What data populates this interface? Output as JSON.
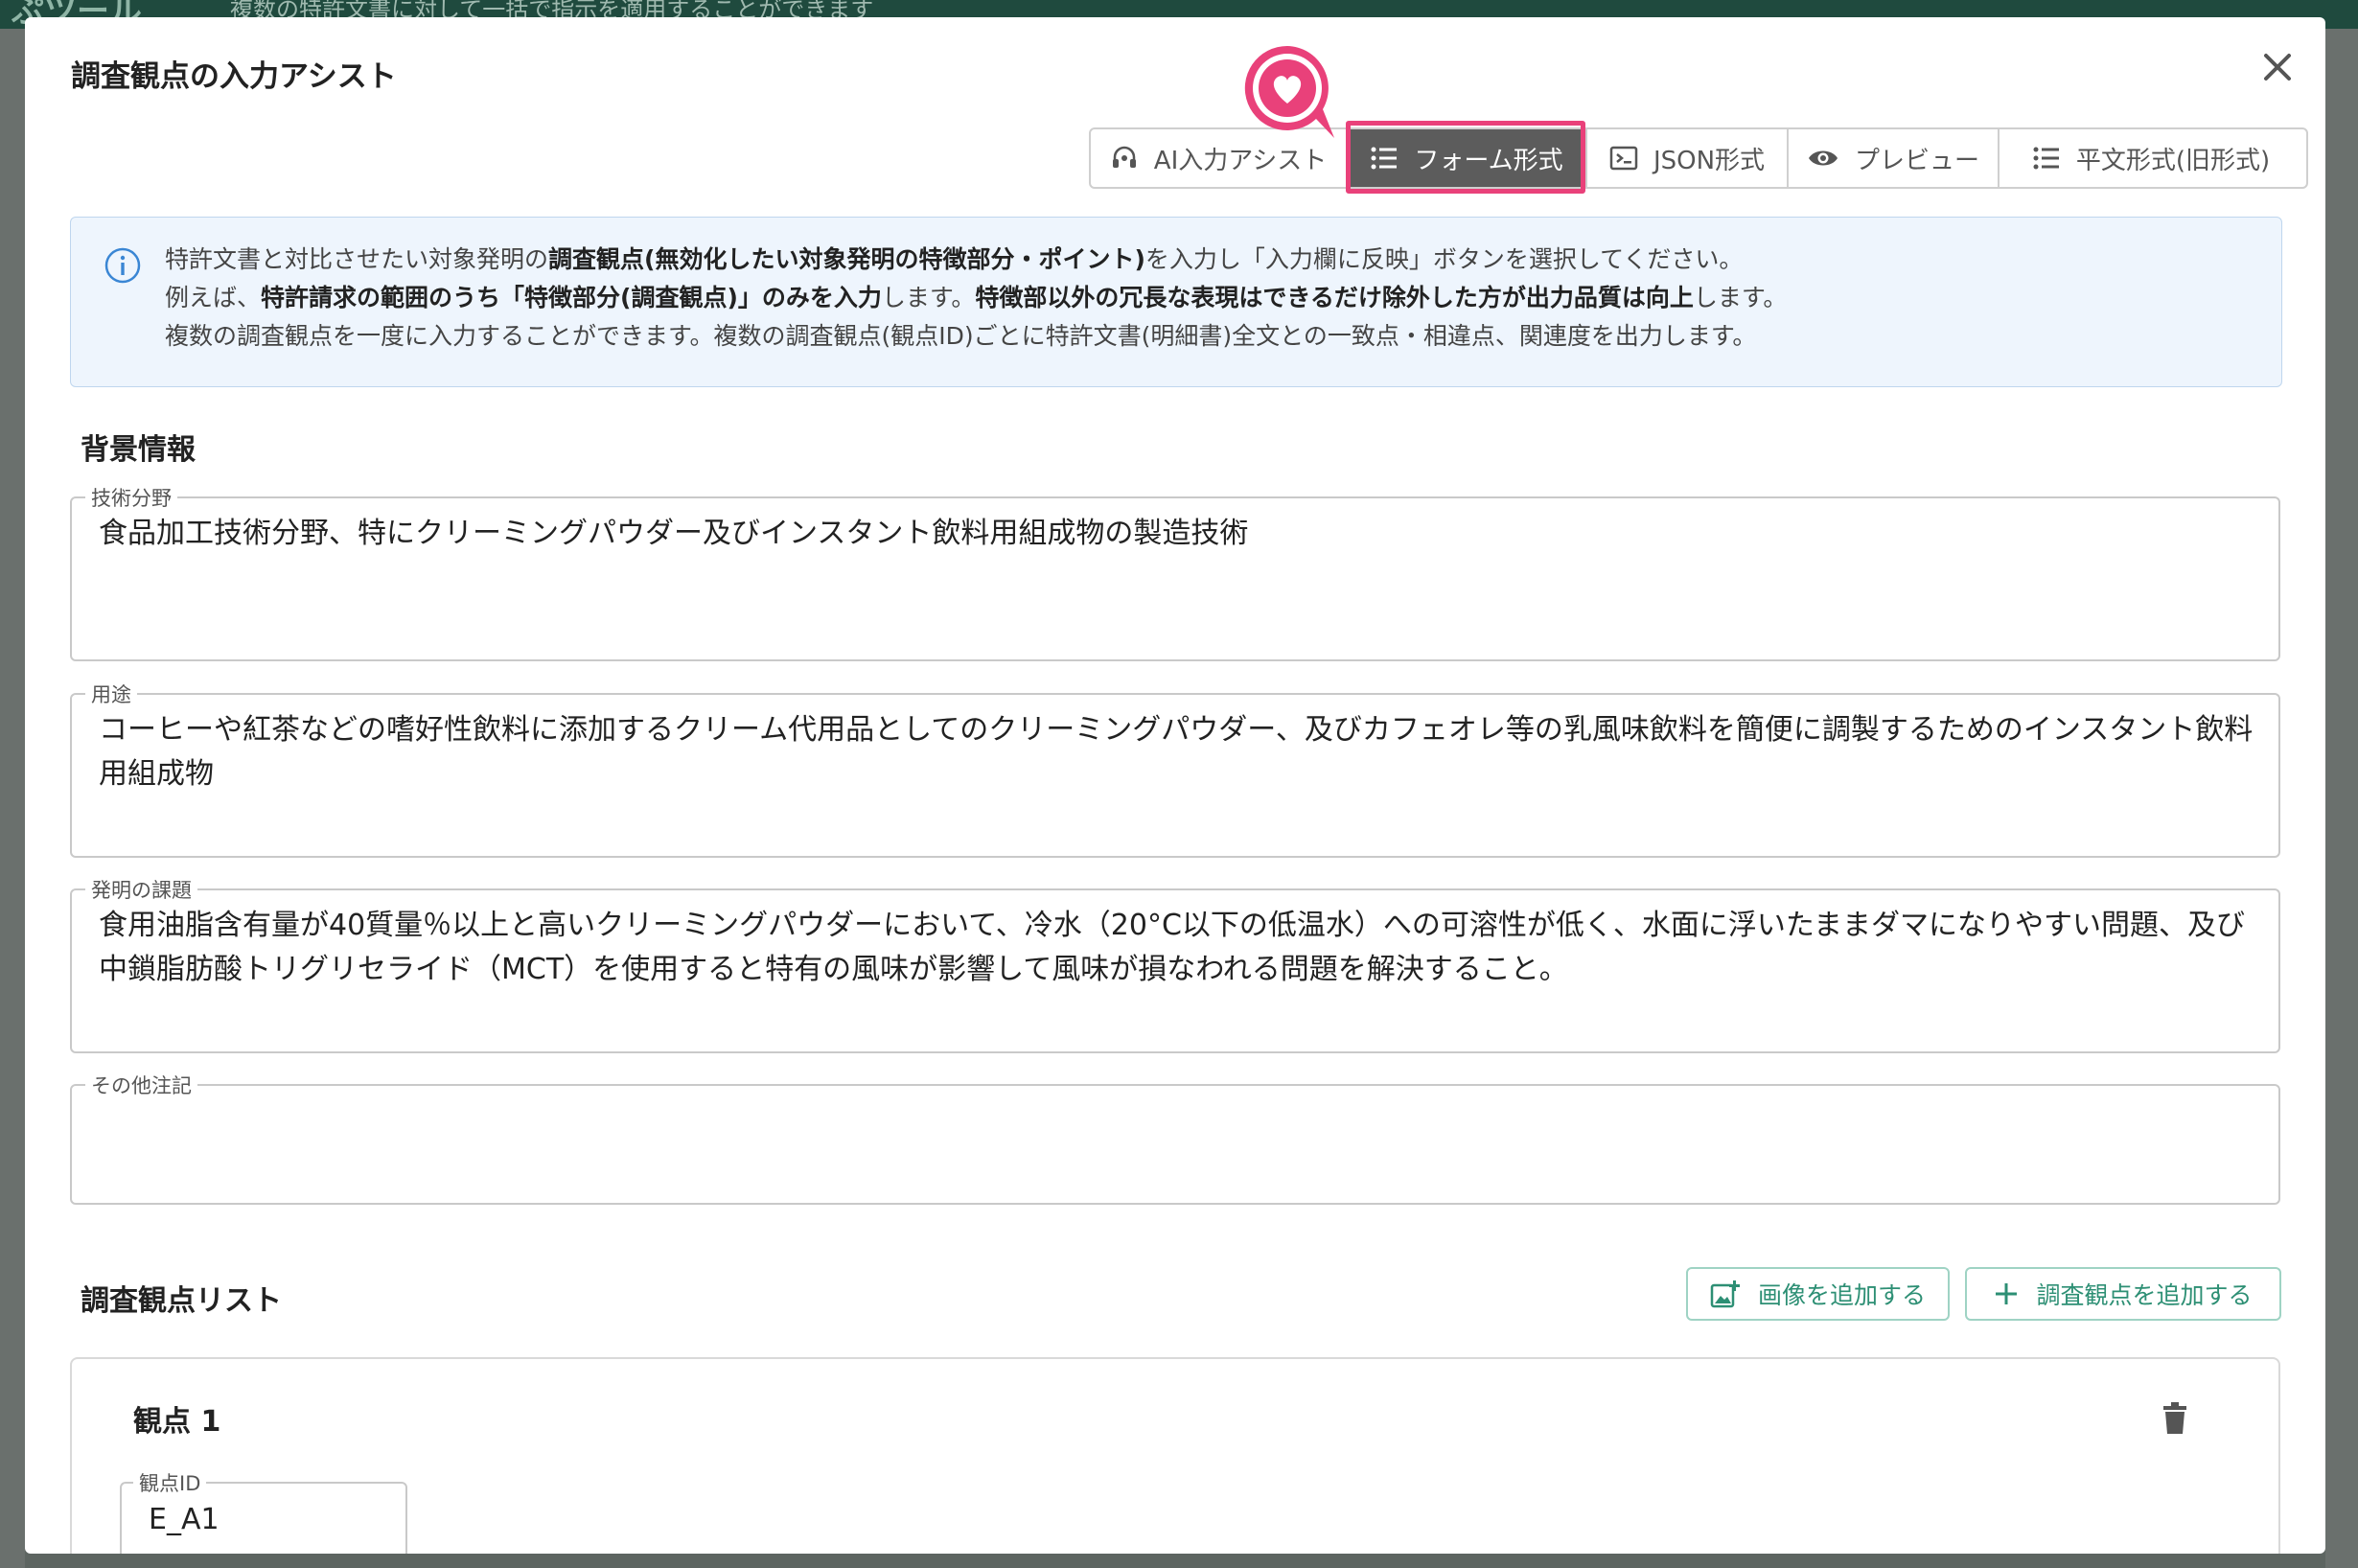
{
  "background": {
    "app_title": "ぷツール",
    "app_subtitle": "複数の特許文書に対して一括で指示を適用することができます"
  },
  "modal": {
    "title": "調査観点の入力アシスト",
    "close_label": "×"
  },
  "tabs": [
    {
      "label": "AI入力アシスト",
      "icon": "headset-icon",
      "active": false
    },
    {
      "label": "フォーム形式",
      "icon": "list-icon",
      "active": true
    },
    {
      "label": "JSON形式",
      "icon": "terminal-icon",
      "active": false
    },
    {
      "label": "プレビュー",
      "icon": "eye-icon",
      "active": false
    },
    {
      "label": "平文形式(旧形式)",
      "icon": "list-icon",
      "active": false
    }
  ],
  "info": {
    "line1_a": "特許文書と対比させたい対象発明の",
    "line1_b": "調査観点(無効化したい対象発明の特徴部分・ポイント)",
    "line1_c": "を入力し「入力欄に反映」ボタンを選択してください。",
    "line2_a": "例えば、",
    "line2_b": "特許請求の範囲のうち「特徴部分(調査観点)」のみを入力",
    "line2_c": "します。",
    "line2_d": "特徴部以外の冗長な表現はできるだけ除外した方が出力品質は向上",
    "line2_e": "します。",
    "line3": "複数の調査観点を一度に入力することができます。複数の調査観点(観点ID)ごとに特許文書(明細書)全文との一致点・相違点、関連度を出力します。"
  },
  "background_section": {
    "title": "背景情報",
    "fields": {
      "tech_field": {
        "label": "技術分野",
        "value": "食品加工技術分野、特にクリーミングパウダー及びインスタント飲料用組成物の製造技術"
      },
      "usage": {
        "label": "用途",
        "value": "コーヒーや紅茶などの嗜好性飲料に添加するクリーム代用品としてのクリーミングパウダー、及びカフェオレ等の乳風味飲料を簡便に調製するためのインスタント飲料用組成物"
      },
      "problem": {
        "label": "発明の課題",
        "value": "食用油脂含有量が40質量％以上と高いクリーミングパウダーにおいて、冷水（20°C以下の低温水）への可溶性が低く、水面に浮いたままダマになりやすい問題、及び中鎖脂肪酸トリグリセライド（MCT）を使用すると特有の風味が影響して風味が損なわれる問題を解決すること。"
      },
      "notes": {
        "label": "その他注記",
        "value": ""
      }
    }
  },
  "viewpoints_section": {
    "title": "調査観点リスト",
    "add_image_label": "画像を追加する",
    "add_viewpoint_label": "調査観点を追加する",
    "items": [
      {
        "title": "観点 1",
        "id_label": "観点ID",
        "id_value": "E_A1"
      }
    ]
  },
  "colors": {
    "accent_pink": "#e9417a",
    "accent_green": "#2d8f74",
    "active_tab": "#5c5c5c",
    "info_bg": "#eef5fd"
  }
}
